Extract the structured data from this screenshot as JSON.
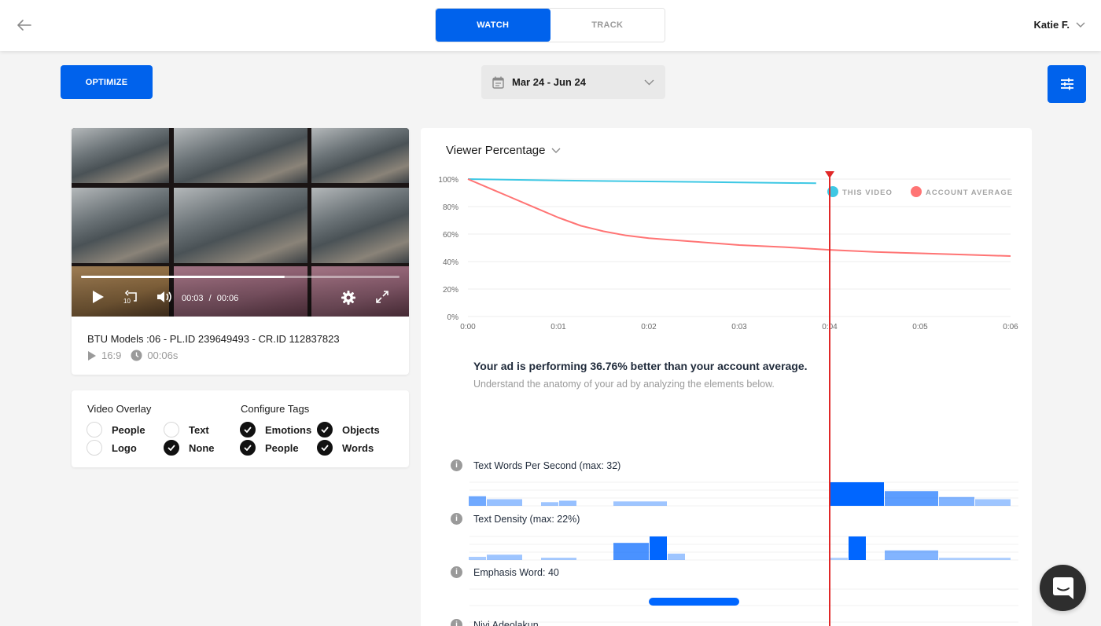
{
  "topbar": {
    "back_icon": "arrow-left-icon",
    "tabs": [
      {
        "label": "WATCH",
        "active": true
      },
      {
        "label": "TRACK",
        "active": false
      }
    ],
    "user_name": "Katie F.",
    "user_menu_icon": "chevron-down-icon"
  },
  "toolbar": {
    "optimize_label": "OPTIMIZE",
    "date_range": "Mar 24 - Jun 24",
    "date_icon": "calendar-icon",
    "filter_icon": "sliders-icon"
  },
  "video": {
    "current_time": "00:03",
    "separator": "/",
    "duration": "00:06",
    "progress": 0.64,
    "title": "BTU Models :06 - PL.ID 239649493 - CR.ID 112837823",
    "aspect_ratio": "16:9",
    "length": "00:06s",
    "icons": [
      "play-icon",
      "rewind-10-icon",
      "volume-icon",
      "settings-icon",
      "fullscreen-icon"
    ]
  },
  "overlay": {
    "video_overlay_title": "Video Overlay",
    "video_overlay_options": [
      {
        "label": "People",
        "checked": false
      },
      {
        "label": "Text",
        "checked": false
      },
      {
        "label": "Logo",
        "checked": false
      },
      {
        "label": "None",
        "checked": true
      }
    ],
    "configure_tags_title": "Configure Tags",
    "configure_tags_options": [
      {
        "label": "Emotions",
        "checked": true
      },
      {
        "label": "Objects",
        "checked": true
      },
      {
        "label": "People",
        "checked": true
      },
      {
        "label": "Words",
        "checked": true
      }
    ]
  },
  "analysis": {
    "metric_label": "Viewer Percentage",
    "performance_title": "Your ad is performing 36.76% better than your account average.",
    "performance_subtitle": "Understand the anatomy of your ad by analyzing the elements below.",
    "playhead_time": 4.0,
    "rows": [
      {
        "label": "Text Words Per Second (max: 32)"
      },
      {
        "label": "Text Density (max: 22%)"
      },
      {
        "label": "Emphasis Word: 40"
      },
      {
        "label": "Niyi Adeolakun"
      }
    ]
  },
  "chart_data": [
    {
      "type": "line",
      "title": "Viewer Percentage",
      "xlabel": "",
      "ylabel": "",
      "x_ticks": [
        "0:00",
        "0:01",
        "0:02",
        "0:03",
        "0:04",
        "0:05",
        "0:06"
      ],
      "y_ticks": [
        "0%",
        "20%",
        "40%",
        "60%",
        "80%",
        "100%"
      ],
      "xlim": [
        0,
        6
      ],
      "ylim": [
        0,
        100
      ],
      "grid": true,
      "legend_position": "top-right",
      "series": [
        {
          "name": "THIS VIDEO",
          "color": "#3ec8e4",
          "x": [
            0,
            1,
            2,
            3,
            3.85
          ],
          "y": [
            100,
            99,
            98.3,
            97.6,
            97
          ]
        },
        {
          "name": "ACCOUNT AVERAGE",
          "color": "#ff7474",
          "x": [
            0,
            0.25,
            0.5,
            0.75,
            1,
            1.25,
            1.5,
            1.75,
            2,
            2.5,
            3,
            3.5,
            4,
            4.5,
            5,
            5.5,
            6
          ],
          "y": [
            100,
            93,
            86,
            79,
            72,
            66,
            62,
            59,
            57,
            54.5,
            52,
            50.5,
            48.5,
            47,
            46,
            45,
            44
          ]
        }
      ]
    },
    {
      "type": "bar",
      "title": "Text Words Per Second (max: 32)",
      "x_unit": "seconds",
      "bars": [
        {
          "start": 0.0,
          "end": 0.2,
          "value": 13,
          "intensity": 0.55
        },
        {
          "start": 0.2,
          "end": 0.6,
          "value": 9,
          "intensity": 0.35
        },
        {
          "start": 0.8,
          "end": 1.0,
          "value": 5,
          "intensity": 0.3
        },
        {
          "start": 1.0,
          "end": 1.2,
          "value": 7,
          "intensity": 0.35
        },
        {
          "start": 1.6,
          "end": 2.2,
          "value": 6,
          "intensity": 0.3
        },
        {
          "start": 4.0,
          "end": 4.6,
          "value": 32,
          "intensity": 1.0
        },
        {
          "start": 4.6,
          "end": 5.2,
          "value": 20,
          "intensity": 0.65
        },
        {
          "start": 5.2,
          "end": 5.6,
          "value": 12,
          "intensity": 0.45
        },
        {
          "start": 5.6,
          "end": 6.0,
          "value": 9,
          "intensity": 0.3
        }
      ]
    },
    {
      "type": "bar",
      "title": "Text Density (max: 22%)",
      "x_unit": "seconds",
      "bars": [
        {
          "start": 0.0,
          "end": 0.2,
          "value": 3,
          "intensity": 0.25
        },
        {
          "start": 0.2,
          "end": 0.6,
          "value": 5,
          "intensity": 0.3
        },
        {
          "start": 0.8,
          "end": 1.2,
          "value": 2,
          "intensity": 0.25
        },
        {
          "start": 1.6,
          "end": 2.0,
          "value": 16,
          "intensity": 0.75
        },
        {
          "start": 2.0,
          "end": 2.2,
          "value": 22,
          "intensity": 1.0
        },
        {
          "start": 2.2,
          "end": 2.4,
          "value": 6,
          "intensity": 0.3
        },
        {
          "start": 4.0,
          "end": 4.2,
          "value": 2,
          "intensity": 0.2
        },
        {
          "start": 4.2,
          "end": 4.4,
          "value": 22,
          "intensity": 1.0
        },
        {
          "start": 4.6,
          "end": 5.2,
          "value": 9,
          "intensity": 0.45
        },
        {
          "start": 5.2,
          "end": 6.0,
          "value": 2,
          "intensity": 0.2
        }
      ]
    },
    {
      "type": "bar",
      "title": "Emphasis Word: 40",
      "x_unit": "seconds",
      "bars": [
        {
          "start": 2.0,
          "end": 3.0,
          "value": 1,
          "intensity": 1.0
        }
      ]
    }
  ]
}
